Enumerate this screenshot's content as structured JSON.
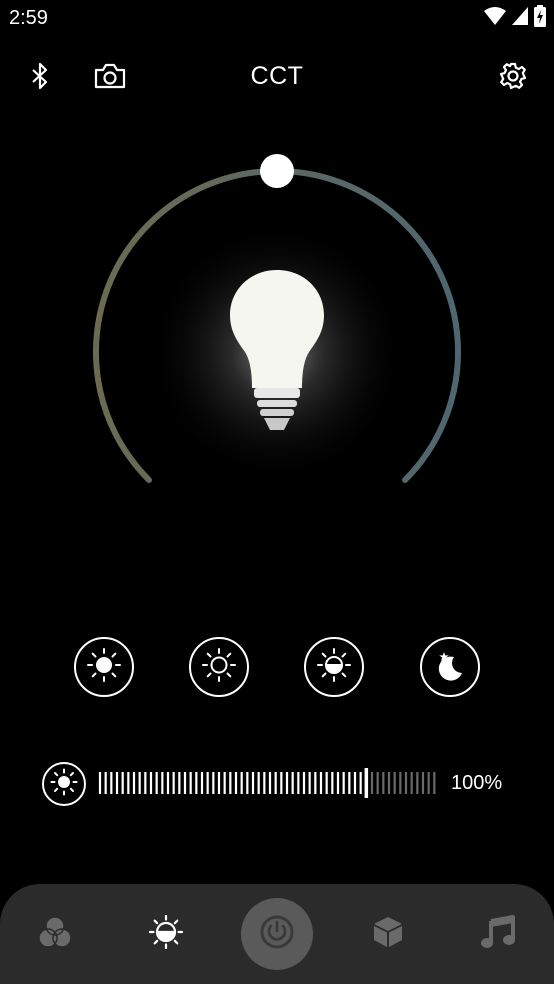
{
  "status_bar": {
    "time": "2:59",
    "icons": [
      "wifi-icon",
      "cellular-signal-icon",
      "battery-charging-icon"
    ]
  },
  "header": {
    "title": "CCT",
    "left_icons": [
      "bluetooth-icon",
      "camera-icon"
    ],
    "right_icon": "gear-icon"
  },
  "dial": {
    "color_temperature_position": 0.5,
    "warm_color": "#6b6b52",
    "cool_color": "#4f6670",
    "bulb_icon": "light-bulb-icon"
  },
  "presets": [
    {
      "name": "bright-sun-preset",
      "icon": "sun-filled-icon"
    },
    {
      "name": "sun-outline-preset",
      "icon": "sun-outline-icon"
    },
    {
      "name": "half-sun-preset",
      "icon": "sun-half-icon"
    },
    {
      "name": "night-preset",
      "icon": "moon-star-icon"
    }
  ],
  "brightness": {
    "icon": "brightness-icon",
    "value_text": "100%",
    "level": 0.8
  },
  "bottom_nav": {
    "background": "#2b2b2b",
    "items": [
      {
        "name": "rgb-mode",
        "icon": "color-circles-icon",
        "active": false
      },
      {
        "name": "cct-mode",
        "icon": "cct-icon",
        "active": true
      },
      {
        "name": "power",
        "icon": "power-icon",
        "active": false
      },
      {
        "name": "scene-mode",
        "icon": "cube-icon",
        "active": false
      },
      {
        "name": "music-mode",
        "icon": "music-note-icon",
        "active": false
      }
    ]
  }
}
